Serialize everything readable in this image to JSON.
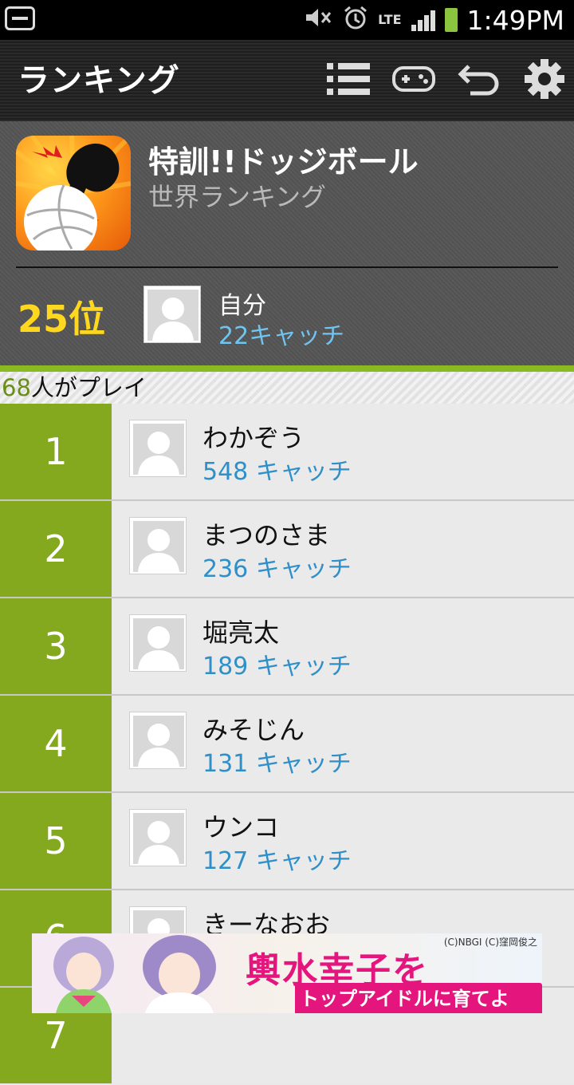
{
  "status_bar": {
    "time": "1:49PM",
    "network": "LTE"
  },
  "action_bar": {
    "title": "ランキング",
    "icons": [
      "list-icon",
      "gamepad-icon",
      "back-icon",
      "settings-icon"
    ]
  },
  "header": {
    "game_title": "特訓!!ドッジボール",
    "subtitle": "世界ランキング",
    "my_rank": "25位",
    "my_name": "自分",
    "my_score": "22キャッチ"
  },
  "players": {
    "count": "68",
    "suffix": "人がプレイ"
  },
  "ranking": [
    {
      "rank": "1",
      "name": "わかぞう",
      "score": "548 キャッチ"
    },
    {
      "rank": "2",
      "name": "まつのさま",
      "score": "236 キャッチ"
    },
    {
      "rank": "3",
      "name": "堀亮太",
      "score": "189 キャッチ"
    },
    {
      "rank": "4",
      "name": "みそじん",
      "score": "131 キャッチ"
    },
    {
      "rank": "5",
      "name": "ウンコ",
      "score": "127 キャッチ"
    },
    {
      "rank": "6",
      "name": "きーなおお",
      "score": ""
    },
    {
      "rank": "7",
      "name": "",
      "score": ""
    }
  ],
  "ad": {
    "credit": "(C)NBGI  (C)窪岡俊之",
    "title": "輿水幸子を",
    "subtitle": "トップアイドルに育てよう！"
  },
  "colors": {
    "accent_green": "#84a91e",
    "rank_yellow": "#ffd71e",
    "score_blue": "#2e8fc9"
  }
}
